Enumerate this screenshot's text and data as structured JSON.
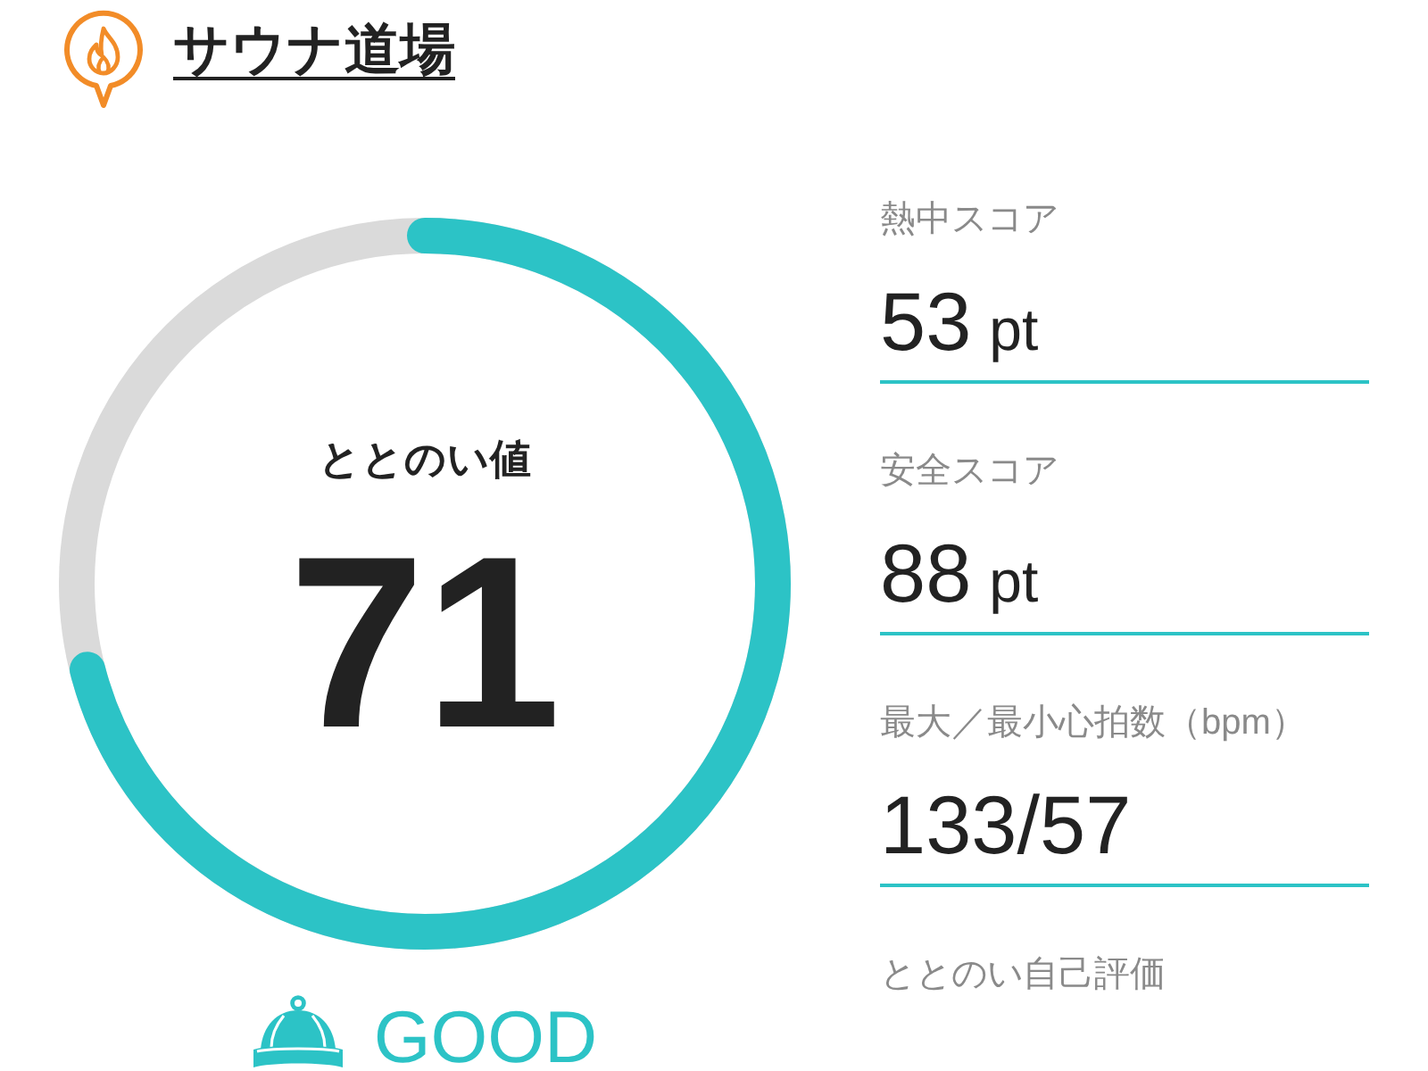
{
  "header": {
    "title": "サウナ道場"
  },
  "score": {
    "label": "ととのい値",
    "value": "71",
    "level": 0.71
  },
  "grade": {
    "label": "GOOD"
  },
  "metrics": [
    {
      "label": "熱中スコア",
      "value": "53",
      "unit": "pt"
    },
    {
      "label": "安全スコア",
      "value": "88",
      "unit": "pt"
    },
    {
      "label": "最大／最小心拍数（bpm）",
      "value": "133/57"
    },
    {
      "label": "ととのい自己評価"
    }
  ]
}
